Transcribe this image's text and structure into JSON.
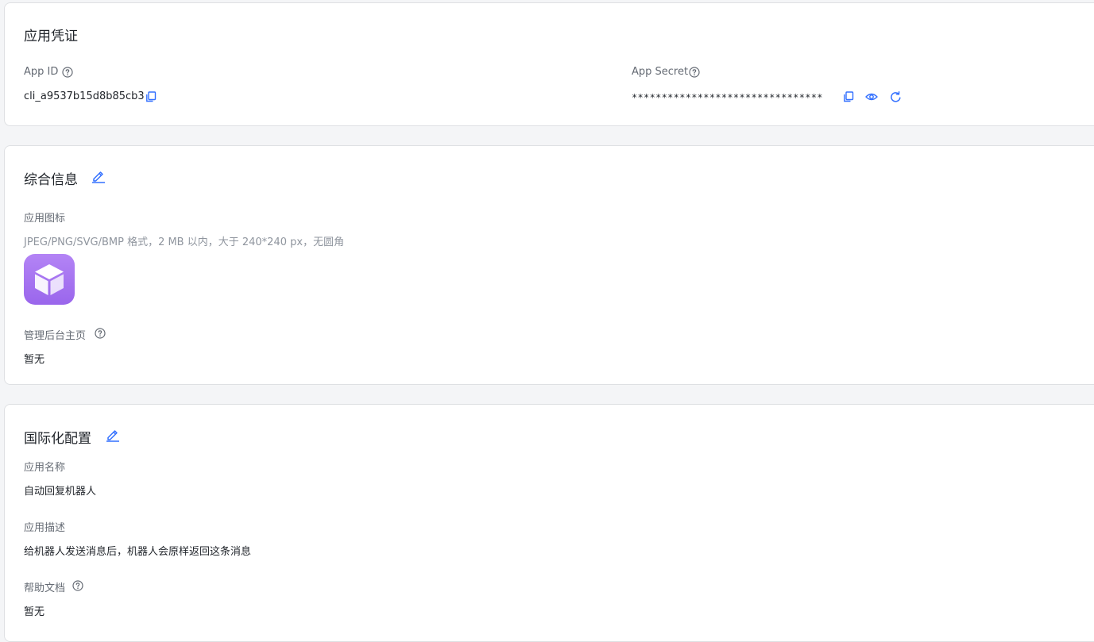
{
  "credentials": {
    "title": "应用凭证",
    "app_id_label": "App ID",
    "app_id_value": "cli_a9537b15d8b85cb3",
    "app_secret_label": "App Secret",
    "app_secret_value": "********************************"
  },
  "general_info": {
    "title": "综合信息",
    "icon_label": "应用图标",
    "icon_hint": "JPEG/PNG/SVG/BMP 格式，2 MB 以内，大于 240*240 px，无圆角",
    "admin_home_label": "管理后台主页",
    "admin_home_value": "暂无"
  },
  "i18n_config": {
    "title": "国际化配置",
    "app_name_label": "应用名称",
    "app_name_value": "自动回复机器人",
    "app_desc_label": "应用描述",
    "app_desc_value": "给机器人发送消息后，机器人会原样返回这条消息",
    "help_doc_label": "帮助文档",
    "help_doc_value": "暂无"
  },
  "icons": {
    "help": "question-circle-icon",
    "copy": "copy-icon",
    "view": "eye-icon",
    "refresh": "refresh-icon",
    "edit": "edit-pencil-icon"
  },
  "colors": {
    "accent": "#3370ff",
    "app_icon_gradient_top": "#b384f5",
    "app_icon_gradient_bottom": "#9a66ec"
  }
}
